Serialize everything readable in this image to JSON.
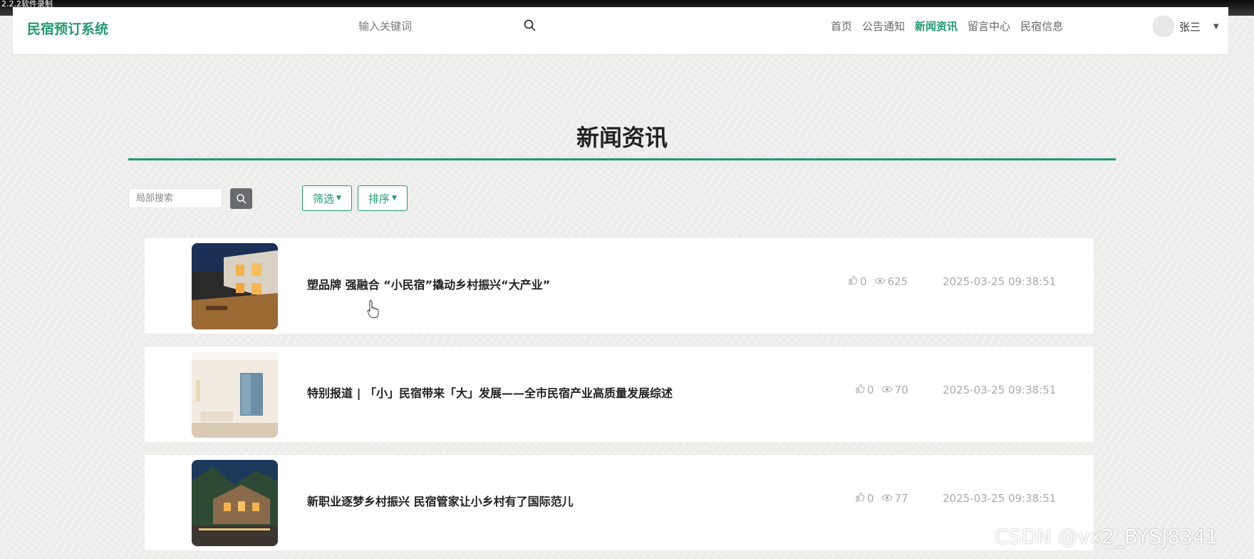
{
  "recorder": {
    "text": "2.2.2软件录制"
  },
  "header": {
    "brand": "民宿预订系统",
    "search_placeholder": "输入关键词",
    "nav": [
      "首页",
      "公告通知",
      "新闻资讯",
      "留言中心",
      "民宿信息"
    ],
    "active_nav": "新闻资讯",
    "user_name": "张三"
  },
  "page": {
    "title": "新闻资讯",
    "local_search_placeholder": "局部搜索",
    "filter_label": "筛选",
    "sort_label": "排序"
  },
  "news": [
    {
      "title": "塑品牌 强融合 “小民宿”撬动乡村振兴“大产业”",
      "likes": "0",
      "views": "625",
      "date": "2025-03-25 09:38:51"
    },
    {
      "title": "特别报道 | 「小」民宿带来「大」发展——全市民宿产业高质量发展综述",
      "likes": "0",
      "views": "70",
      "date": "2025-03-25 09:38:51"
    },
    {
      "title": "新职业逐梦乡村振兴 民宿管家让小乡村有了国际范儿",
      "likes": "0",
      "views": "77",
      "date": "2025-03-25 09:38:51"
    }
  ],
  "watermark": "CSDN @vx2_BYSJ8341",
  "colors": {
    "accent": "#1f9a6b",
    "background": "#eeeeec"
  }
}
